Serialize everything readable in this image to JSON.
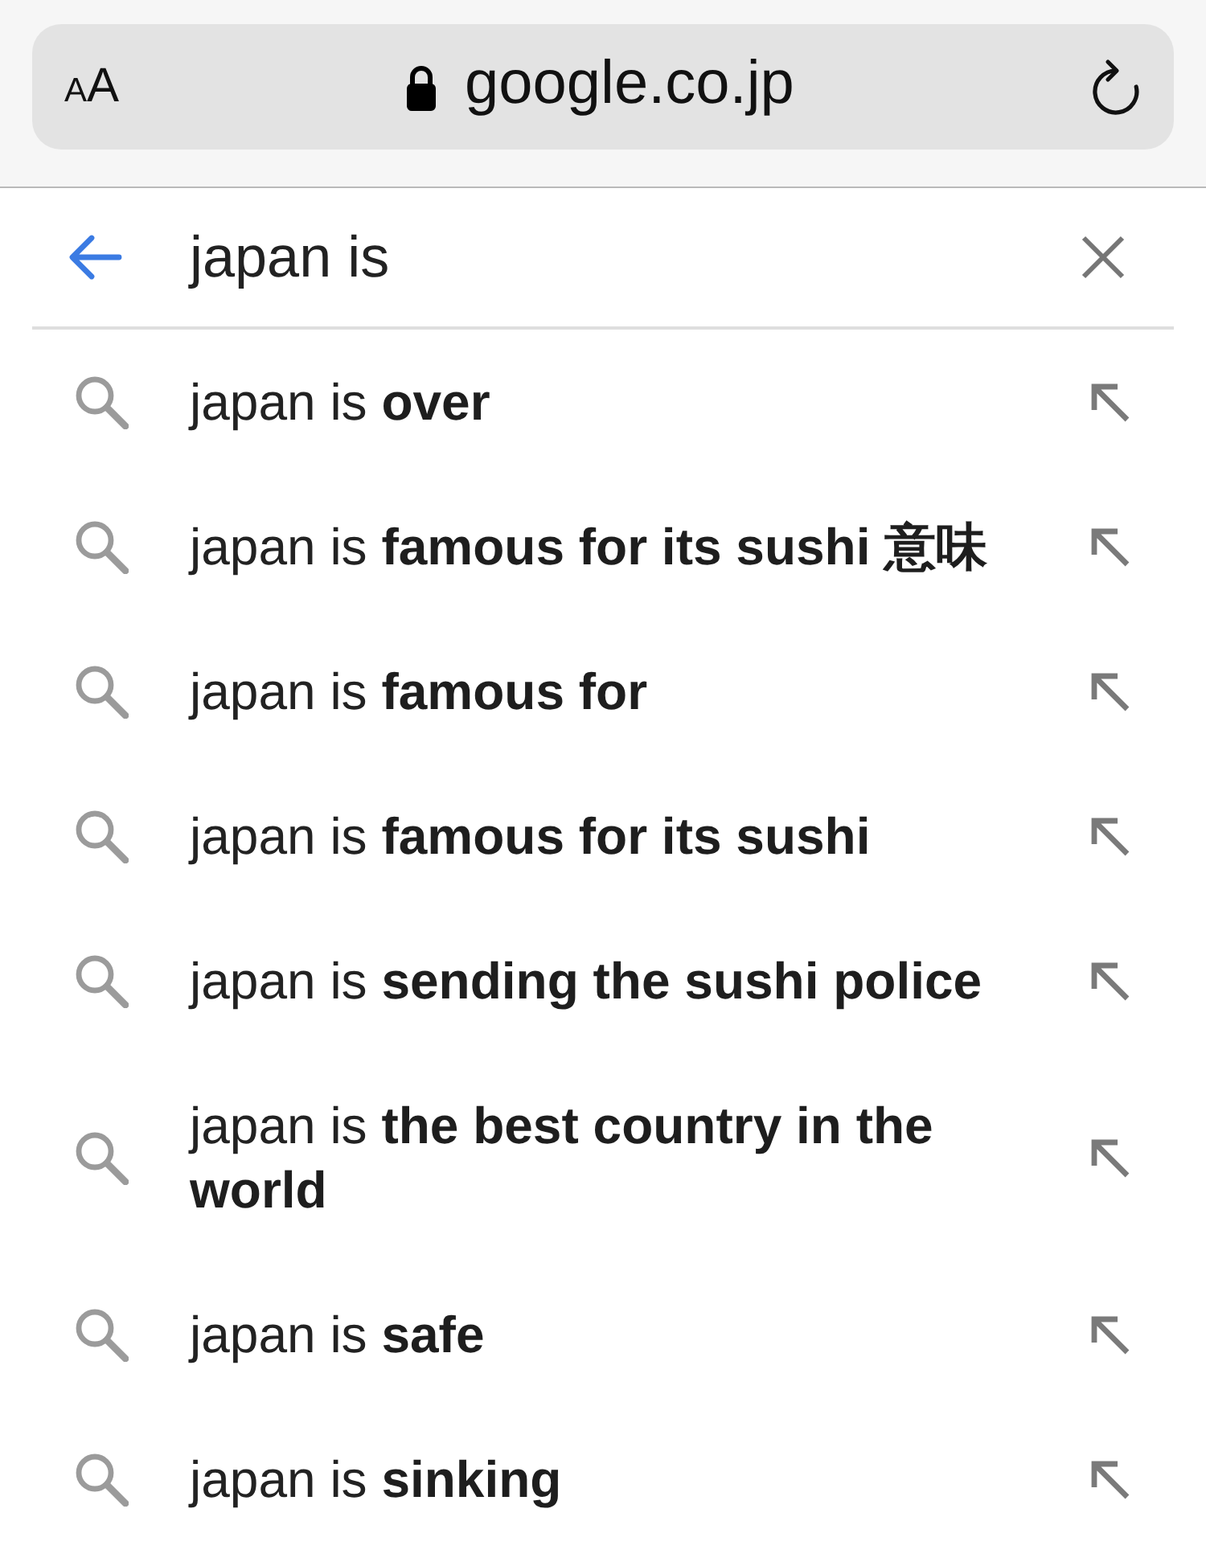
{
  "browser_bar": {
    "text_size_label": "AA",
    "url": "google.co.jp"
  },
  "search": {
    "value": "japan is"
  },
  "suggestions": [
    {
      "text": "japan is **over**"
    },
    {
      "text": "japan is **famous for its sushi 意味**"
    },
    {
      "text": "japan is **famous for**"
    },
    {
      "text": "japan is **famous for its sushi**"
    },
    {
      "text": "japan is **sending the sushi police**"
    },
    {
      "text": "japan is **the best country in the world**"
    },
    {
      "text": "japan is **safe**"
    },
    {
      "text": "japan is **sinking**"
    }
  ]
}
